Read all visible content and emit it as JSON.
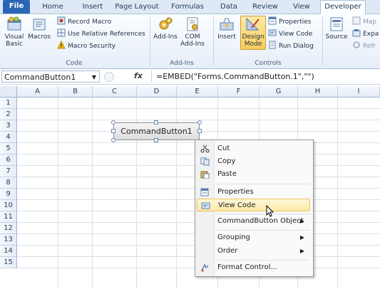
{
  "tabs": [
    "File",
    "Home",
    "Insert",
    "Page Layout",
    "Formulas",
    "Data",
    "Review",
    "View",
    "Developer"
  ],
  "ribbon": {
    "code": {
      "visual_basic": "Visual\nBasic",
      "macros": "Macros",
      "record_macro": "Record Macro",
      "relative_refs": "Use Relative References",
      "macro_security": "Macro Security",
      "label": "Code"
    },
    "addins": {
      "addins": "Add-Ins",
      "com": "COM",
      "com2": "Add-Ins",
      "label": "Add-Ins"
    },
    "controls": {
      "insert": "Insert",
      "design1": "Design",
      "design2": "Mode",
      "properties": "Properties",
      "view_code": "View Code",
      "run_dialog": "Run Dialog",
      "label": "Controls"
    },
    "xml": {
      "source": "Source",
      "map": "Map",
      "expand": "Expa",
      "refresh": "Refr"
    }
  },
  "formula_bar": {
    "name_box": "CommandButton1",
    "fx": "fx",
    "formula": "=EMBED(\"Forms.CommandButton.1\",\"\")"
  },
  "grid": {
    "columns": [
      "A",
      "B",
      "C",
      "D",
      "E",
      "F",
      "G",
      "H",
      "I"
    ],
    "rows": [
      "1",
      "2",
      "3",
      "4",
      "5",
      "6",
      "7",
      "8",
      "9",
      "10",
      "11",
      "12",
      "13",
      "14",
      "15"
    ]
  },
  "command_button": {
    "label": "CommandButton1"
  },
  "context_menu": {
    "cut": "Cut",
    "copy": "Copy",
    "paste": "Paste",
    "properties": "Properties",
    "view_code": "View Code",
    "object": "CommandButton Object",
    "grouping": "Grouping",
    "order": "Order",
    "format_control": "Format Control..."
  }
}
